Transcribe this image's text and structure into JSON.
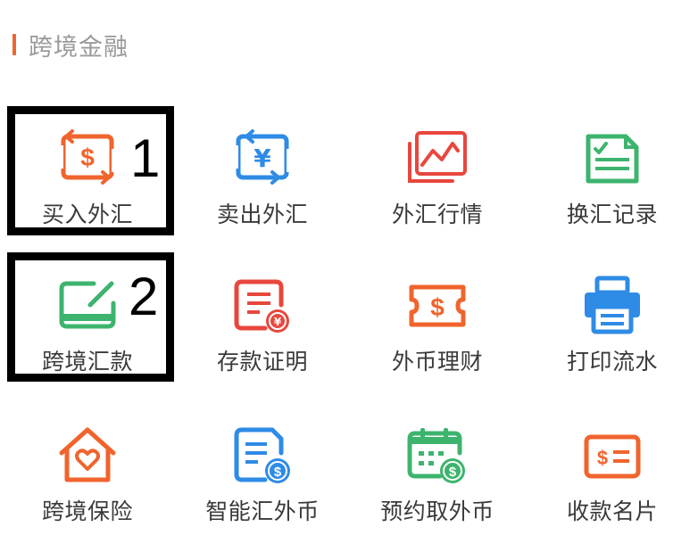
{
  "section": {
    "title": "跨境金融"
  },
  "annotations": [
    "1",
    "2"
  ],
  "colors": {
    "accent": "#F0642D",
    "orange": "#F0642D",
    "blue": "#2E8BE6",
    "red": "#E8473E",
    "green": "#3DB46E"
  },
  "items": [
    {
      "label": "买入外汇",
      "icon": "buy-forex-icon"
    },
    {
      "label": "卖出外汇",
      "icon": "sell-forex-icon"
    },
    {
      "label": "外汇行情",
      "icon": "forex-market-icon"
    },
    {
      "label": "换汇记录",
      "icon": "exchange-record-icon"
    },
    {
      "label": "跨境汇款",
      "icon": "cross-border-remittance-icon"
    },
    {
      "label": "存款证明",
      "icon": "deposit-certificate-icon"
    },
    {
      "label": "外币理财",
      "icon": "foreign-currency-wealth-icon"
    },
    {
      "label": "打印流水",
      "icon": "print-statement-icon"
    },
    {
      "label": "跨境保险",
      "icon": "cross-border-insurance-icon"
    },
    {
      "label": "智能汇外币",
      "icon": "smart-remit-icon"
    },
    {
      "label": "预约取外币",
      "icon": "reserve-withdraw-icon"
    },
    {
      "label": "收款名片",
      "icon": "payment-card-icon"
    }
  ]
}
